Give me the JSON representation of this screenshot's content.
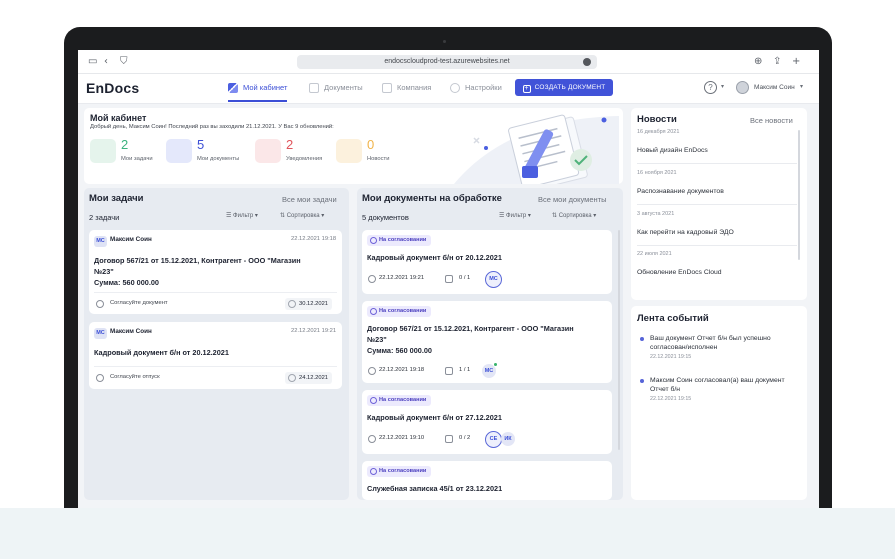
{
  "browser": {
    "url": "endocscloudprod-test.azurewebsites.net"
  },
  "app": {
    "logo": "EnDocs",
    "nav": [
      "Мой кабинет",
      "Документы",
      "Компания",
      "Настройки"
    ],
    "create_button": "СОЗДАТЬ ДОКУМЕНТ",
    "help": "?",
    "user": "Максим Соин"
  },
  "cabinet": {
    "title": "Мой кабинет",
    "subtitle": "Добрый день, Максим Соин! Последний раз вы заходили 21.12.2021. У Вас 9 обновлений:",
    "stats": [
      {
        "value": "2",
        "label": "Мои задачи",
        "color": "#3bb27d",
        "tile": "#e5f4ec"
      },
      {
        "value": "5",
        "label": "Мои документы",
        "color": "#3c4fd6",
        "tile": "#e4e8fb"
      },
      {
        "value": "2",
        "label": "Уведомления",
        "color": "#e0545b",
        "tile": "#fbe7e8"
      },
      {
        "value": "0",
        "label": "Новости",
        "color": "#f0b44a",
        "tile": "#fcf1dd"
      }
    ]
  },
  "news": {
    "title": "Новости",
    "all_link": "Все новости",
    "items": [
      {
        "date": "16 декабря 2021",
        "title": "Новый дизайн EnDocs"
      },
      {
        "date": "16 ноября 2021",
        "title": "Распознавание документов"
      },
      {
        "date": "3 августа 2021",
        "title": "Как перейти на кадровый ЭДО"
      },
      {
        "date": "22 июля 2021",
        "title": "Обновление EnDocs Cloud"
      }
    ]
  },
  "feed": {
    "title": "Лента событий",
    "items": [
      {
        "text": "Ваш документ Отчет б/н был успешно согласован/исполнен",
        "date": "22.12.2021 19:15"
      },
      {
        "text": "Максим Соин согласовал(а) ваш документ Отчет б/н",
        "date": "22.12.2021 19:15"
      }
    ]
  },
  "tasks": {
    "title": "Мои задачи",
    "all_link": "Все мои задачи",
    "count": "2 задачи",
    "filter": "Фильтр",
    "sort": "Сортировка",
    "cards": [
      {
        "initials": "МС",
        "author": "Максим Соин",
        "date": "22.12.2021 19:18",
        "title_lines": [
          "Договор 567/21 от 15.12.2021, Контрагент - ООО \"Магазин",
          "№23\"",
          "Сумма: 560 000.00"
        ],
        "note": "Согласуйте документ",
        "due": "30.12.2021"
      },
      {
        "initials": "МС",
        "author": "Максим Соин",
        "date": "22.12.2021 19:21",
        "title_lines": [
          "Кадровый документ б/н от 20.12.2021"
        ],
        "note": "Согласуйте отпуск",
        "due": "24.12.2021"
      }
    ]
  },
  "documents": {
    "title": "Мои документы на обработке",
    "all_link": "Все мои документы",
    "count": "5 документов",
    "filter": "Фильтр",
    "sort": "Сортировка",
    "cards": [
      {
        "status": "На согласовании",
        "title_lines": [
          "Кадровый документ б/н от 20.12.2021"
        ],
        "datetime": "22.12.2021 19:21",
        "progress": "0 / 1",
        "avatars": [
          "МС"
        ]
      },
      {
        "status": "На согласовании",
        "title_lines": [
          "Договор 567/21 от 15.12.2021, Контрагент - ООО \"Магазин",
          "№23\"",
          "Сумма: 560 000.00"
        ],
        "datetime": "22.12.2021 19:18",
        "progress": "1 / 1",
        "avatars": [
          "МС"
        ]
      },
      {
        "status": "На согласовании",
        "title_lines": [
          "Кадровый документ б/н от 27.12.2021"
        ],
        "datetime": "22.12.2021 19:10",
        "progress": "0 / 2",
        "avatars": [
          "СЕ",
          "ИК"
        ]
      },
      {
        "status": "На согласовании",
        "title_lines": [
          "Служебная записка 45/1 от 23.12.2021"
        ]
      }
    ]
  }
}
